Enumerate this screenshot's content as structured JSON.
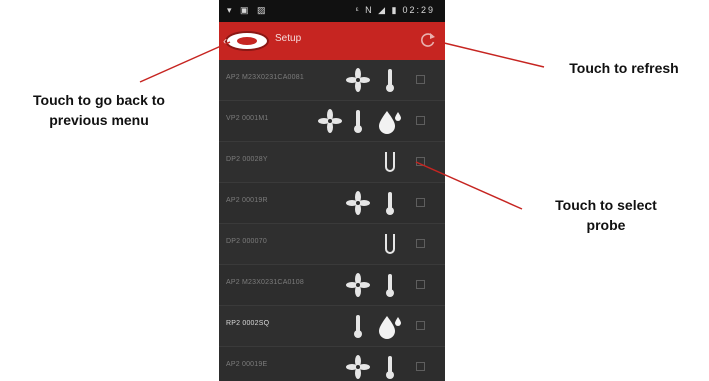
{
  "status_bar": {
    "clock": "02:29"
  },
  "app_bar": {
    "title": "Setup"
  },
  "probes": [
    {
      "name": "AP2 M23X0231CA0081",
      "icons": [
        "fan-icon",
        "thermometer-icon"
      ],
      "bright": false
    },
    {
      "name": "VP2 0001M1",
      "icons": [
        "fan-icon",
        "thermometer-icon",
        "humidity-icon"
      ],
      "bright": false
    },
    {
      "name": "DP2 00028Y",
      "icons": [
        "pressure-probe-icon"
      ],
      "bright": false
    },
    {
      "name": "AP2 00019R",
      "icons": [
        "fan-icon",
        "thermometer-icon"
      ],
      "bright": false
    },
    {
      "name": "DP2 000070",
      "icons": [
        "pressure-probe-icon"
      ],
      "bright": false
    },
    {
      "name": "AP2 M23X0231CA0108",
      "icons": [
        "fan-icon",
        "thermometer-icon"
      ],
      "bright": false
    },
    {
      "name": "RP2 0002SQ",
      "icons": [
        "thermometer-icon",
        "humidity-icon"
      ],
      "bright": true
    },
    {
      "name": "AP2 00019E",
      "icons": [
        "fan-icon",
        "thermometer-icon"
      ],
      "bright": false
    }
  ],
  "callouts": {
    "back": "Touch to go back to previous menu",
    "refresh": "Touch to refresh",
    "select": "Touch to select probe"
  },
  "colors": {
    "accent_red": "#c62521",
    "list_bg": "#2d2d2d"
  }
}
